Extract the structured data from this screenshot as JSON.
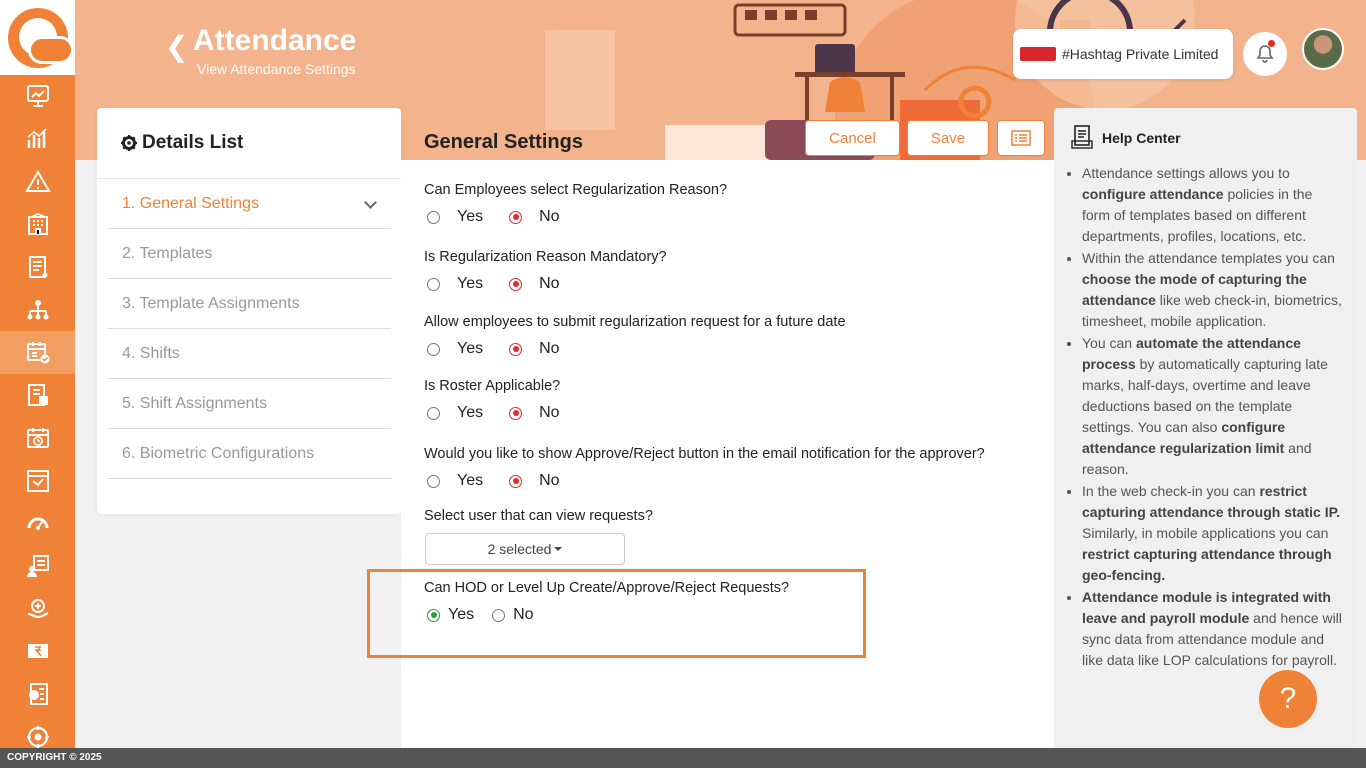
{
  "header": {
    "title": "Attendance",
    "subtitle": "View Attendance Settings",
    "company_name": "#Hashtag Private Limited"
  },
  "details_list": {
    "title": "Details List",
    "items": [
      {
        "label": "1. General Settings",
        "active": true
      },
      {
        "label": "2. Templates"
      },
      {
        "label": "3. Template Assignments"
      },
      {
        "label": "4. Shifts"
      },
      {
        "label": "5. Shift Assignments"
      },
      {
        "label": "6. Biometric Configurations"
      }
    ]
  },
  "settings": {
    "title": "General Settings",
    "cancel_label": "Cancel",
    "save_label": "Save",
    "yes_label": "Yes",
    "no_label": "No",
    "questions": [
      {
        "text": "Can Employees select Regularization Reason?",
        "selected": "No"
      },
      {
        "text": "Is Regularization Reason Mandatory?",
        "selected": "No"
      },
      {
        "text": "Allow employees to submit regularization request for a future date",
        "selected": "No"
      },
      {
        "text": "Is Roster Applicable?",
        "selected": "No"
      },
      {
        "text": "Would you like to show Approve/Reject button in the email notification for the approver?",
        "selected": "No"
      }
    ],
    "view_requests_label": "Select user that can view requests?",
    "view_requests_value": "2 selected",
    "hod_question": "Can HOD or Level Up Create/Approve/Reject Requests?",
    "hod_selected": "Yes"
  },
  "help_center": {
    "title": "Help Center",
    "fab_label": "?"
  },
  "footer": {
    "text": "COPYRIGHT © 2025"
  },
  "colors": {
    "accent": "#ef8237",
    "radio_red": "#e02b2b",
    "radio_green": "#2e9a3a"
  }
}
